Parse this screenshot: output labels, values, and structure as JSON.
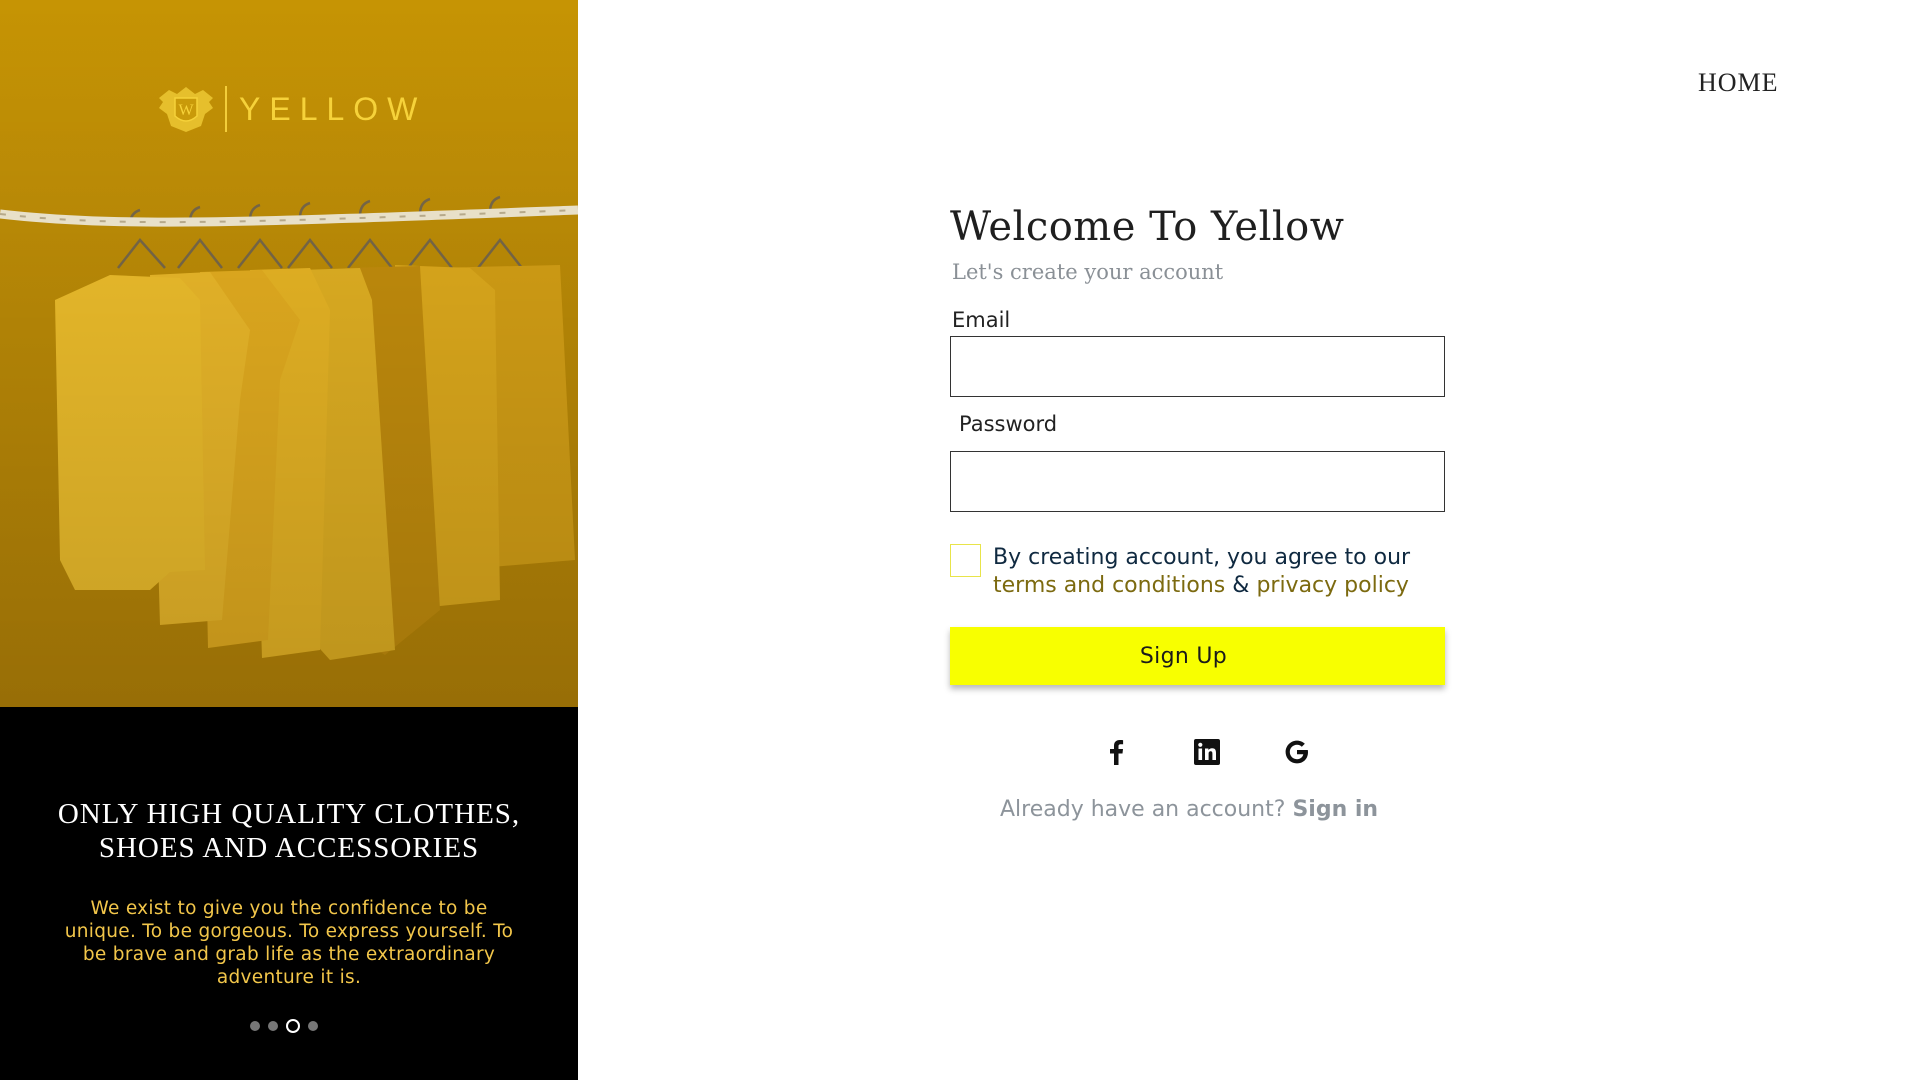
{
  "brand": {
    "name": "YELLOW",
    "logo_icon": "crest-icon",
    "accent": "#f6d23a"
  },
  "hero": {
    "image": "clothes-on-rack",
    "headline_line1": "ONLY HIGH QUALITY CLOTHES,",
    "headline_line2": "SHOES AND ACCESSORIES",
    "body": "We exist to give you the confidence to be unique. To be gorgeous. To express yourself. To be brave and grab life as the extraordinary adventure it is.",
    "carousel": {
      "count": 4,
      "active_index": 2
    }
  },
  "nav": {
    "home": "HOME"
  },
  "form": {
    "title": "Welcome To Yellow",
    "subtitle": "Let's create your account",
    "email_label": "Email",
    "email_value": "",
    "password_label": "Password",
    "password_value": "",
    "agree_checked": false,
    "terms_prefix": "By creating account, you agree to our",
    "terms_link": "terms and conditions",
    "terms_amp": "&",
    "privacy_link": "privacy policy",
    "submit_label": "Sign Up",
    "submit_color": "#f8ff00",
    "social": [
      "facebook-icon",
      "linkedin-icon",
      "google-icon"
    ],
    "signin_prompt": "Already have an account?",
    "signin_link": "Sign in"
  }
}
